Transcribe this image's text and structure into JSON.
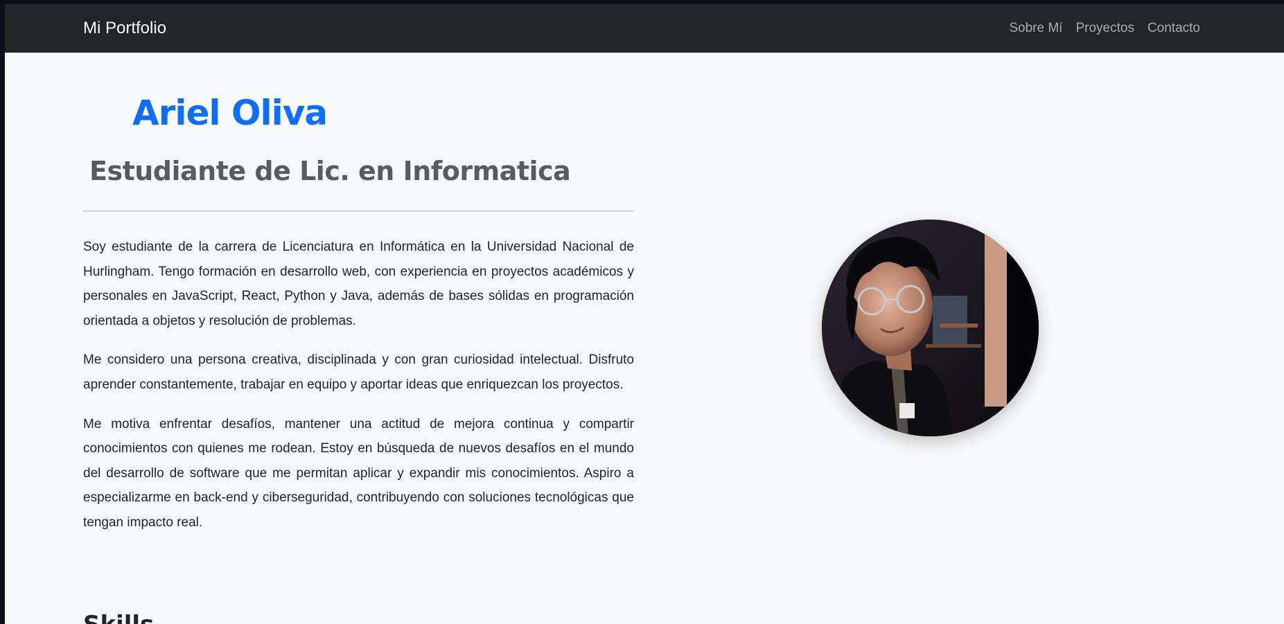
{
  "navbar": {
    "brand": "Mi Portfolio",
    "links": [
      "Sobre Mí",
      "Proyectos",
      "Contacto"
    ]
  },
  "hero": {
    "name": "Ariel Oliva",
    "subtitle": "Estudiante de Lic. en Informatica"
  },
  "bio": {
    "paragraphs": [
      "Soy estudiante de la carrera de Licenciatura en Informática en la Universidad Nacional de Hurlingham. Tengo formación en desarrollo web, con experiencia en proyectos académicos y personales en JavaScript, React, Python y Java, además de bases sólidas en programación orientada a objetos y resolución de problemas.",
      "Me considero una persona creativa, disciplinada y con gran curiosidad intelectual. Disfruto aprender constantemente, trabajar en equipo y aportar ideas que enriquezcan los proyectos.",
      "Me motiva enfrentar desafíos, mantener una actitud de mejora continua y compartir conocimientos con quienes me rodean. Estoy en búsqueda de nuevos desafíos en el mundo del desarrollo de software que me permitan aplicar y expandir mis conocimientos. Aspiro a especializarme en back-end y ciberseguridad, contribuyendo con soluciones tecnológicas que tengan impacto real."
    ]
  },
  "skills": {
    "heading": "Skills"
  },
  "colors": {
    "navbar_bg": "#212529",
    "accent": "#0d6efd",
    "page_bg": "#f8f9fa"
  }
}
